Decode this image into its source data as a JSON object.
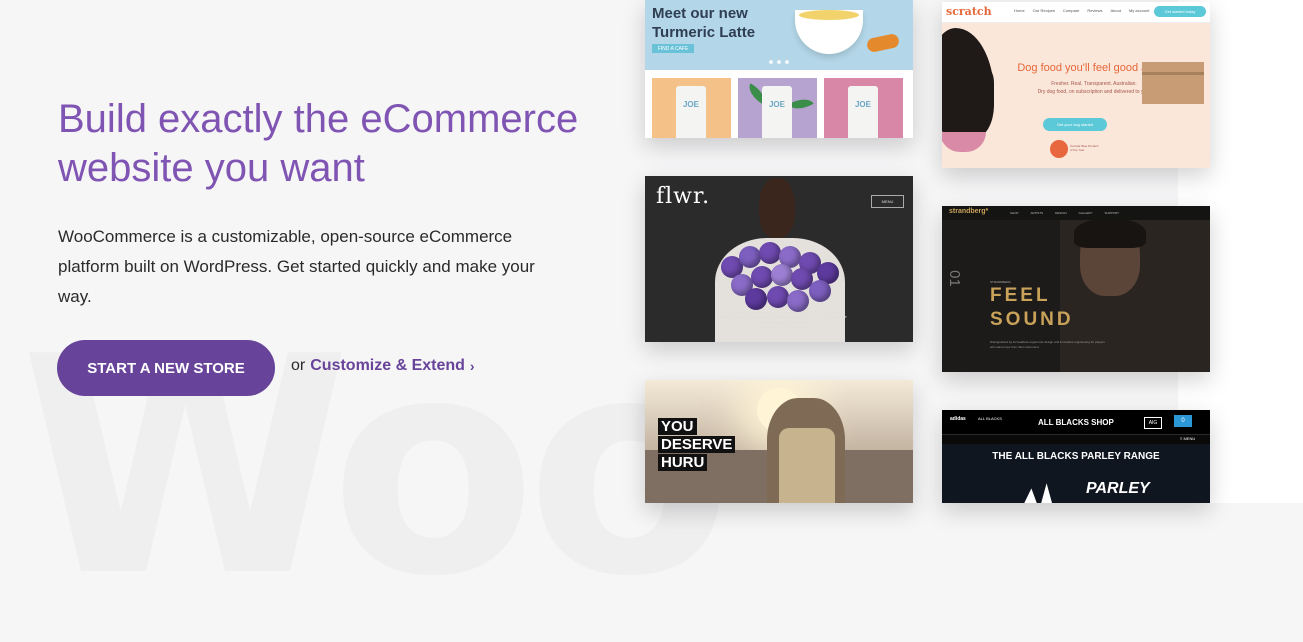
{
  "watermark": "Woo",
  "hero": {
    "title": "Build exactly the eCommerce website you want",
    "description": "WooCommerce is a customizable, open-source eCommerce platform built on WordPress. Get started quickly and make your way.",
    "cta_label": "START A NEW STORE",
    "or_text": "or",
    "secondary_link": "Customize & Extend",
    "chevron": "›"
  },
  "colors": {
    "accent": "#7f54b3",
    "button": "#674399",
    "background": "#f6f6f7"
  },
  "showcase": {
    "joe": {
      "headline": "Meet our new Turmeric Latte",
      "button": "FIND A CAFE",
      "bag_label": "JOE",
      "product_colors": [
        "#f4c288",
        "#b6a3cf",
        "#d887a7"
      ]
    },
    "scratch": {
      "logo": "scratch",
      "nav": [
        "Home",
        "Our Recipes",
        "Compare",
        "Reviews",
        "About",
        "My account",
        "Contact"
      ],
      "nav_cta": "Get started today",
      "headline": "Dog food you'll feel good about",
      "sub1": "Fresher. Real. Transparent. Australian.",
      "sub2": "Dry dog food, on subscription and delivered to you.",
      "button": "Get your dog started",
      "award": "Canstar Blue Product of the Year"
    },
    "flwr": {
      "logo": "flwr.",
      "menu": "MENU",
      "caption": "Flowers arranged by hand and delivered across the city for your favourite people and special occasions"
    },
    "strandberg": {
      "logo": "strandberg*",
      "nav": [
        "SHOP",
        "ARTISTS",
        "DESIGN",
        "GALLERY",
        "SUPPORT"
      ],
      "num": "01",
      "small": "STRANDBERG",
      "headline1": "FEEL",
      "headline2": "SOUND",
      "caption": "Distinguished by its headless ergonomic design and innovative engineering for players who want more from their instrument."
    },
    "huru": {
      "line1": "YOU",
      "line2": "DESERVE",
      "line3": "HURU"
    },
    "allblacks": {
      "adidas": "adidas",
      "fern": "ALL BLACKS",
      "shop": "ALL BLACKS SHOP",
      "aig": "AIG",
      "cart": "0",
      "menu": "≡ MENU",
      "headline": "THE ALL BLACKS PARLEY RANGE",
      "parley": "PARLEY"
    }
  }
}
